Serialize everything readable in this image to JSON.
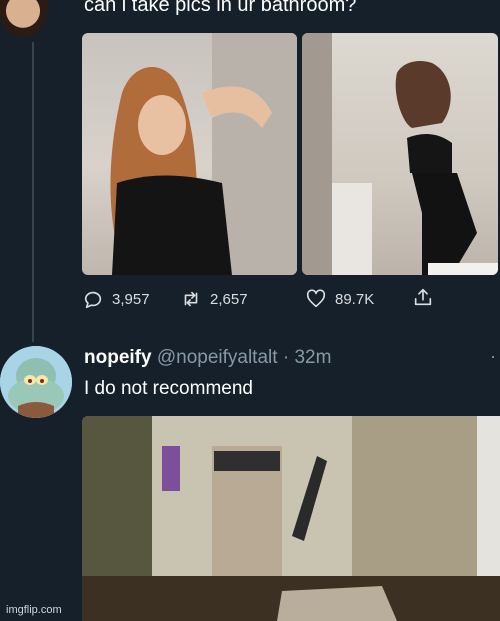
{
  "tweet1": {
    "text": "can i take pics in ur bathroom?",
    "stats": {
      "replies": "3,957",
      "retweets": "2,657",
      "likes": "89.7K"
    }
  },
  "tweet2": {
    "display_name": "nopeify",
    "handle": "@nopeifyaltalt",
    "separator": "·",
    "time": "32m",
    "text": "I do not recommend",
    "more": "·"
  },
  "watermark": "imgflip.com",
  "icons": {
    "reply": "reply-icon",
    "retweet": "retweet-icon",
    "like": "heart-icon",
    "share": "share-icon"
  },
  "colors": {
    "background": "#15202b",
    "muted": "#8899a6",
    "text": "#ffffff"
  }
}
